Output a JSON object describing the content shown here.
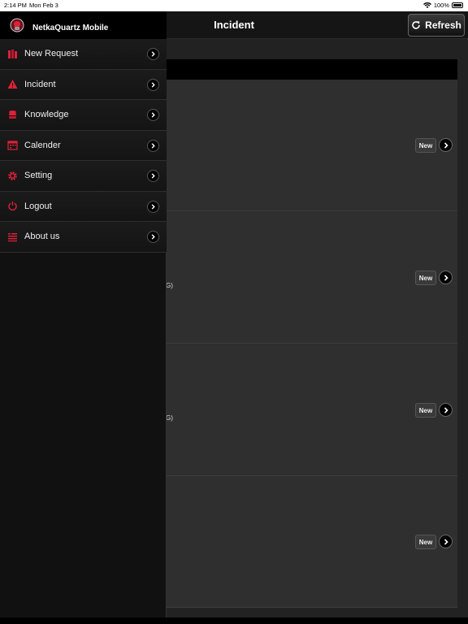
{
  "status_bar": {
    "time": "2:14 PM",
    "date": "Mon Feb 3",
    "battery": "100%"
  },
  "navbar": {
    "title": "Incident",
    "refresh_label": "Refresh"
  },
  "drawer": {
    "app_title": "NetkaQuartz Mobile",
    "items": [
      {
        "label": "New Request",
        "icon": "books-icon"
      },
      {
        "label": "Incident",
        "icon": "warning-icon"
      },
      {
        "label": "Knowledge",
        "icon": "database-icon"
      },
      {
        "label": "Calender",
        "icon": "calendar-icon"
      },
      {
        "label": "Setting",
        "icon": "gear-icon"
      },
      {
        "label": "Logout",
        "icon": "power-icon"
      },
      {
        "label": "About us",
        "icon": "list-icon"
      }
    ]
  },
  "rows": [
    {
      "badge": "New",
      "fragment": ""
    },
    {
      "badge": "New",
      "fragment": "G)"
    },
    {
      "badge": "New",
      "fragment": "G)"
    },
    {
      "badge": "New",
      "fragment": ""
    }
  ],
  "colors": {
    "accent_red": "#e0203a",
    "bg": "#222222"
  }
}
